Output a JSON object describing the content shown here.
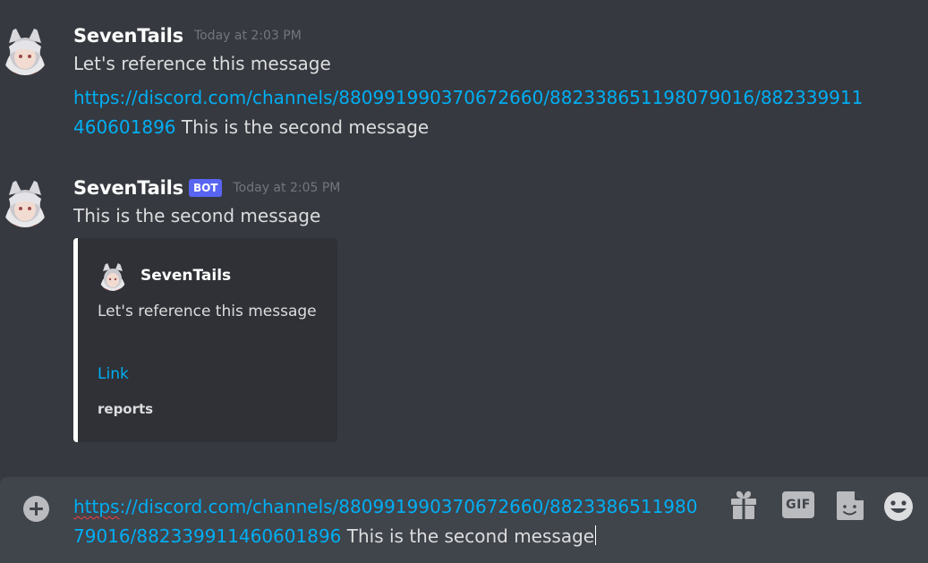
{
  "messages": [
    {
      "username": "SevenTails",
      "timestamp": "Today at 2:03 PM",
      "text": "Let's reference this message",
      "link_line_url": "https://discord.com/channels/880991990370672660/882338651198079016/882339911460601896",
      "link_line_text": " This is the second message"
    },
    {
      "username": "SevenTails",
      "bot_tag": "BOT",
      "timestamp": "Today at 2:05 PM",
      "text": "This is the second message",
      "embed": {
        "author_name": "SevenTails",
        "description": "Let's reference this message",
        "link_label": "Link",
        "footer": "reports",
        "border_color": "#ffffff"
      }
    }
  ],
  "composer": {
    "url_prefix_misspelled": "https",
    "url_rest": "://discord.com/channels/880991990370672660/882338651198079016/882339911460601896",
    "text": " This is the second message",
    "buttons": [
      "plus-circle-icon",
      "gift-icon",
      "gif-icon",
      "sticker-icon",
      "emoji-icon"
    ],
    "gif_label": "GIF"
  },
  "colors": {
    "background": "#36393f",
    "link": "#00aff4",
    "bot_tag": "#5865f2",
    "composer": "#40444b"
  }
}
